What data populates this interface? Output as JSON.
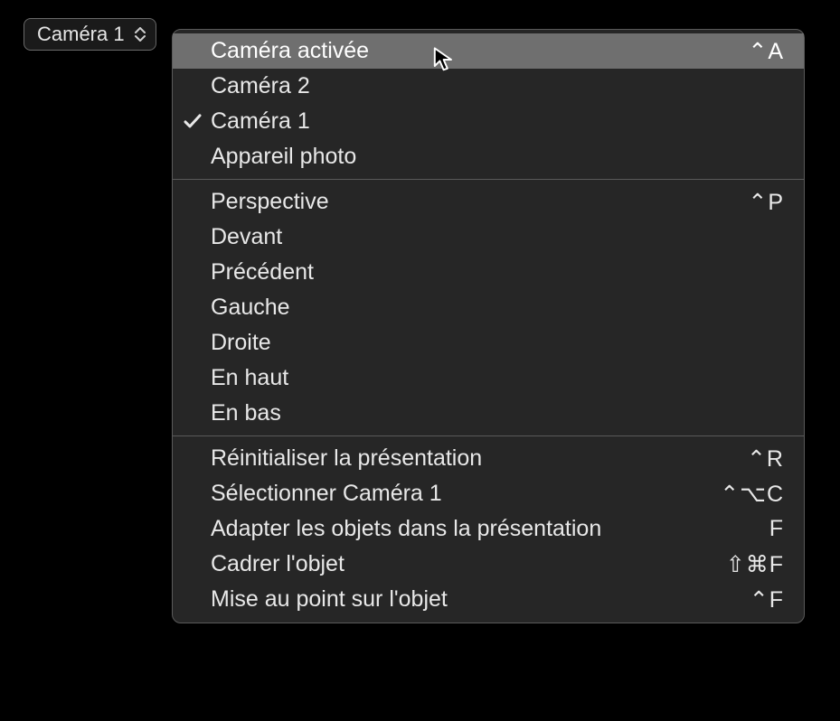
{
  "trigger": {
    "label": "Caméra 1"
  },
  "menu": {
    "sections": [
      {
        "items": [
          {
            "label": "Caméra activée",
            "shortcut": "⌃A",
            "checked": false,
            "highlight": true
          },
          {
            "label": "Caméra 2",
            "shortcut": "",
            "checked": false,
            "highlight": false
          },
          {
            "label": "Caméra 1",
            "shortcut": "",
            "checked": true,
            "highlight": false
          },
          {
            "label": "Appareil photo",
            "shortcut": "",
            "checked": false,
            "highlight": false
          }
        ]
      },
      {
        "items": [
          {
            "label": "Perspective",
            "shortcut": "⌃P",
            "checked": false,
            "highlight": false
          },
          {
            "label": "Devant",
            "shortcut": "",
            "checked": false,
            "highlight": false
          },
          {
            "label": "Précédent",
            "shortcut": "",
            "checked": false,
            "highlight": false
          },
          {
            "label": "Gauche",
            "shortcut": "",
            "checked": false,
            "highlight": false
          },
          {
            "label": "Droite",
            "shortcut": "",
            "checked": false,
            "highlight": false
          },
          {
            "label": "En haut",
            "shortcut": "",
            "checked": false,
            "highlight": false
          },
          {
            "label": "En bas",
            "shortcut": "",
            "checked": false,
            "highlight": false
          }
        ]
      },
      {
        "items": [
          {
            "label": "Réinitialiser la présentation",
            "shortcut": "⌃R",
            "checked": false,
            "highlight": false
          },
          {
            "label": "Sélectionner Caméra 1",
            "shortcut": "⌃⌥C",
            "checked": false,
            "highlight": false
          },
          {
            "label": "Adapter les objets dans la présentation",
            "shortcut": "F",
            "checked": false,
            "highlight": false
          },
          {
            "label": "Cadrer l'objet",
            "shortcut": "⇧⌘F",
            "checked": false,
            "highlight": false
          },
          {
            "label": "Mise au point sur l'objet",
            "shortcut": "⌃F",
            "checked": false,
            "highlight": false
          }
        ]
      }
    ]
  }
}
